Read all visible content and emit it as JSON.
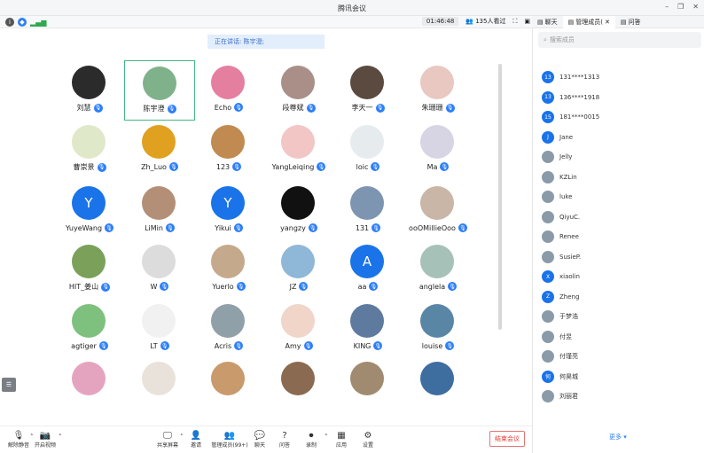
{
  "window": {
    "title": "腾讯会议"
  },
  "toolbar": {
    "timer": "01:46:48",
    "watching": "135人看过"
  },
  "right_tabs": [
    {
      "label": "聊天",
      "active": false
    },
    {
      "label": "管理成员(",
      "active": true
    },
    {
      "label": "问答",
      "active": false
    }
  ],
  "speaking": {
    "text": "正在讲话: 陈宇澄;"
  },
  "participants": [
    {
      "name": "刘慧",
      "letter": "",
      "color": "#2b2b2b",
      "active": false
    },
    {
      "name": "陈宇澄",
      "letter": "",
      "color": "#7fb28a",
      "active": true
    },
    {
      "name": "Echo",
      "letter": "",
      "color": "#e57fa0",
      "active": false
    },
    {
      "name": "段尊斌",
      "letter": "",
      "color": "#a98f88",
      "active": false
    },
    {
      "name": "李天一",
      "letter": "",
      "color": "#5a4a3f",
      "active": false
    },
    {
      "name": "朱珊珊",
      "letter": "",
      "color": "#e8c8c0",
      "active": false
    },
    {
      "name": "曹崇景",
      "letter": "",
      "color": "#dfe8c8",
      "active": false
    },
    {
      "name": "Zh_Luo",
      "letter": "",
      "color": "#e0a020",
      "active": false
    },
    {
      "name": "123",
      "letter": "",
      "color": "#c08a50",
      "active": false
    },
    {
      "name": "YangLeiqing",
      "letter": "",
      "color": "#f3c6c6",
      "active": false
    },
    {
      "name": "loic",
      "letter": "",
      "color": "#e6ebee",
      "active": false
    },
    {
      "name": "Ma",
      "letter": "",
      "color": "#d7d4e4",
      "active": false
    },
    {
      "name": "YuyeWang",
      "letter": "Y",
      "color": "#1a73e8",
      "active": false
    },
    {
      "name": "LiMin",
      "letter": "",
      "color": "#b38f77",
      "active": false
    },
    {
      "name": "Yikui",
      "letter": "Y",
      "color": "#1a73e8",
      "active": false
    },
    {
      "name": "yangzy",
      "letter": "",
      "color": "#111111",
      "active": false
    },
    {
      "name": "131",
      "letter": "",
      "color": "#7d95b0",
      "active": false
    },
    {
      "name": "ooOMillieOoo",
      "letter": "",
      "color": "#c9b6a6",
      "active": false
    },
    {
      "name": "HIT_姜山",
      "letter": "",
      "color": "#7aa05a",
      "active": false
    },
    {
      "name": "W",
      "letter": "",
      "color": "#dcdcdc",
      "active": false
    },
    {
      "name": "Yuerlo",
      "letter": "",
      "color": "#c5a98c",
      "active": false
    },
    {
      "name": "JZ",
      "letter": "",
      "color": "#8fb7d8",
      "active": false
    },
    {
      "name": "aa",
      "letter": "A",
      "color": "#1a73e8",
      "active": false
    },
    {
      "name": "anglela",
      "letter": "",
      "color": "#a6c1b8",
      "active": false
    },
    {
      "name": "agtiger",
      "letter": "",
      "color": "#7ec07e",
      "active": false
    },
    {
      "name": "LT",
      "letter": "",
      "color": "#f1f1f1",
      "active": false
    },
    {
      "name": "Acris",
      "letter": "",
      "color": "#90a0a8",
      "active": false
    },
    {
      "name": "Amy",
      "letter": "",
      "color": "#f0d5c8",
      "active": false
    },
    {
      "name": "KING",
      "letter": "",
      "color": "#5e7a9e",
      "active": false
    },
    {
      "name": "louise",
      "letter": "",
      "color": "#5a86a6",
      "active": false
    },
    {
      "name": "",
      "letter": "",
      "color": "#e4a4c0",
      "active": false
    },
    {
      "name": "",
      "letter": "",
      "color": "#e8e2da",
      "active": false
    },
    {
      "name": "",
      "letter": "",
      "color": "#c89a6c",
      "active": false
    },
    {
      "name": "",
      "letter": "",
      "color": "#8a6a50",
      "active": false
    },
    {
      "name": "",
      "letter": "",
      "color": "#a08a70",
      "active": false
    },
    {
      "name": "",
      "letter": "",
      "color": "#3e6ea0",
      "active": false
    }
  ],
  "member_panel": {
    "search_placeholder": "搜索成员",
    "more_label": "更多",
    "members": [
      {
        "avatar": "13",
        "name": "131****1313"
      },
      {
        "avatar": "13",
        "name": "136****1918"
      },
      {
        "avatar": "15",
        "name": "181****0015"
      },
      {
        "avatar": "J",
        "name": "Jane"
      },
      {
        "avatar": "",
        "name": "Jelly"
      },
      {
        "avatar": "",
        "name": "KZLin"
      },
      {
        "avatar": "",
        "name": "luke"
      },
      {
        "avatar": "",
        "name": "QiyuC."
      },
      {
        "avatar": "",
        "name": "Renee"
      },
      {
        "avatar": "",
        "name": "SusieP."
      },
      {
        "avatar": "X",
        "name": "xiaolin"
      },
      {
        "avatar": "Z",
        "name": "Zheng"
      },
      {
        "avatar": "",
        "name": "于梦浩"
      },
      {
        "avatar": "",
        "name": "付昱"
      },
      {
        "avatar": "",
        "name": "付瑾亮"
      },
      {
        "avatar": "何",
        "name": "何昊城"
      },
      {
        "avatar": "",
        "name": "刘丽君"
      }
    ]
  },
  "bottom_bar": {
    "unmute": "解除静音",
    "video": "开启视频",
    "share": "共享屏幕",
    "invite": "邀请",
    "members": "管理成员(99+)",
    "chat": "聊天",
    "qa": "问答",
    "record": "录制",
    "apps": "应用",
    "settings": "设置",
    "end": "结束会议"
  }
}
